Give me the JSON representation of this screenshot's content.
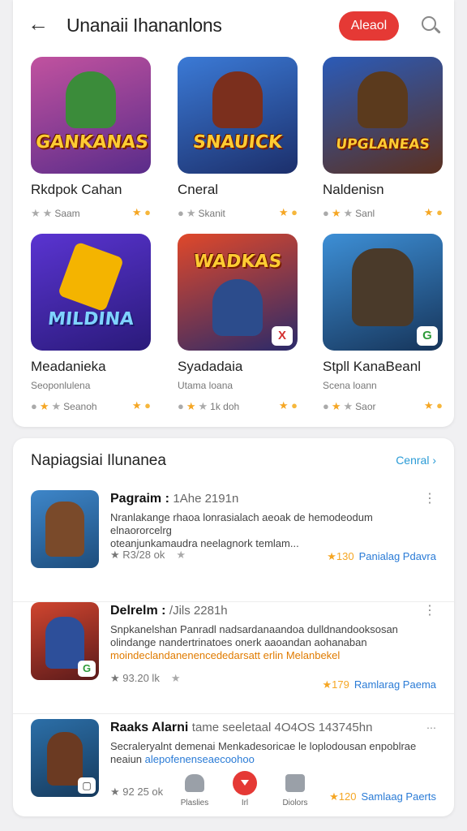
{
  "header": {
    "title": "Unanaii Ihananlons",
    "action_label": "Aleaol"
  },
  "grid": [
    {
      "name": "Rkdpok Cahan",
      "banner": "GANKANAS",
      "thumb_bg": "#a7489a",
      "fig_color": "#3b8c3a",
      "sub": "",
      "row1": "Saam",
      "badge": ""
    },
    {
      "name": "Cneral",
      "banner": "SNAUICK",
      "thumb_bg": "#2a63c4",
      "fig_color": "#7b2f1d",
      "sub": "",
      "row1": "Skanit",
      "badge": ""
    },
    {
      "name": "Naldenisn",
      "banner": "UPGLANEAS",
      "thumb_bg": "#1c3f8f",
      "fig_color": "#5b3a1d",
      "sub": "",
      "row1": "Sanl",
      "badge": ""
    },
    {
      "name": "Meadanieka",
      "banner": "MILDINA",
      "thumb_bg": "#4b28b3",
      "fig_color": "#f4b400",
      "sub": "Seoponlulena",
      "row1": "Seanoh",
      "badge": ""
    },
    {
      "name": "Syadadaia",
      "banner": "WADKAS",
      "thumb_bg": "#3a3680",
      "fig_color": "#2c4c8c",
      "sub": "Utama loana",
      "row1": "1k doh",
      "badge": "X"
    },
    {
      "name": "Stpll KanaBeanl",
      "banner": "",
      "thumb_bg": "#2f6fb3",
      "fig_color": "#4a3a2a",
      "sub": "Scena loann",
      "row1": "Saor",
      "badge": "G"
    }
  ],
  "section": {
    "title": "Napiagsiai Ilunanea",
    "see_all": "Cenral",
    "items": [
      {
        "title": "Pagraim :",
        "meta": "1Ahe 2191n",
        "desc_1": "Nranlakange rhaoa lonrasialach aeoak de hemodeodum elnaororcelrg",
        "desc_2": "oteanjunkamaudra neelagnork temlam...",
        "desc_hl": "",
        "stats": "R3/28 ok",
        "right_num": "130",
        "right_text": "Panialag Pdavra",
        "thumb_bg": "#3e86c9",
        "fig_color": "#7a4a2a",
        "badge": ""
      },
      {
        "title": "Delrelm :",
        "meta": "/Jils 2281h",
        "desc_1": "Snpkanelshan Panradl nadsardanaandoa dulldnandooksosan",
        "desc_2": "olindange nandertrinatoes onerk aaoandan aohanaban",
        "desc_hl": "moindeclandanenencededarsatt erlin Melanbekel",
        "stats": "93.20 lk",
        "right_num": "179",
        "right_text": "Ramlarag Paema",
        "thumb_bg": "#b2362b",
        "fig_color": "#2d4f9a",
        "badge": "G"
      },
      {
        "title": "Raaks Alarni",
        "meta": "tame seeletaal 4O4OS 143745hn",
        "desc_1": "Secraleryalnt demenai Menkadesoricae le loplodousan enpoblrae",
        "desc_2": "neaiun",
        "desc_hl": "alepofenenseaecoohoo",
        "stats": "92 25 ok",
        "right_num": "120",
        "right_text": "Samlaag Paerts",
        "thumb_bg": "#2c6fa8",
        "fig_color": "#6b3a22",
        "badge": "▢"
      }
    ]
  },
  "bottom_nav": [
    {
      "label": "Plaslies"
    },
    {
      "label": "Irl"
    },
    {
      "label": "Diolors"
    }
  ],
  "colors": {
    "accent": "#e53935",
    "link": "#2a9bd6",
    "star": "#f5a623"
  }
}
